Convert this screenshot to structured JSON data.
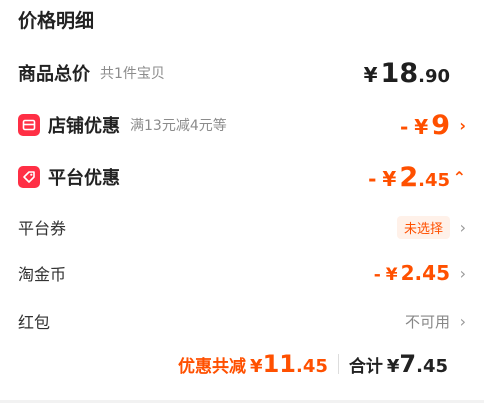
{
  "title": "价格明细",
  "summary": {
    "label": "商品总价",
    "sub": "共1件宝贝",
    "currency": "¥",
    "int": "18",
    "dec": ".90"
  },
  "shop_discount": {
    "icon": "shop-icon",
    "label": "店铺优惠",
    "sub": "满13元减4元等",
    "prefix": "-",
    "currency": "¥",
    "int": "9",
    "arrow": "›"
  },
  "platform_discount": {
    "icon": "tag-icon",
    "label": "平台优惠",
    "prefix": "-",
    "currency": "¥",
    "int": "2",
    "dec": ".45",
    "arrow": "⌃"
  },
  "details": [
    {
      "label": "平台券",
      "value": "未选择"
    },
    {
      "label": "淘金币",
      "prefix": "-",
      "currency": "¥",
      "amount": "2.45"
    },
    {
      "label": "红包",
      "value": "不可用"
    }
  ],
  "footer": {
    "discount_label": "优惠共减",
    "discount_currency": "¥",
    "discount_int": "11",
    "discount_dec": ".45",
    "total_label": "合计",
    "total_currency": "¥",
    "total_int": "7",
    "total_dec": ".45"
  },
  "colors": {
    "accent": "#ff5000",
    "icon_red": "#ff2f45"
  }
}
